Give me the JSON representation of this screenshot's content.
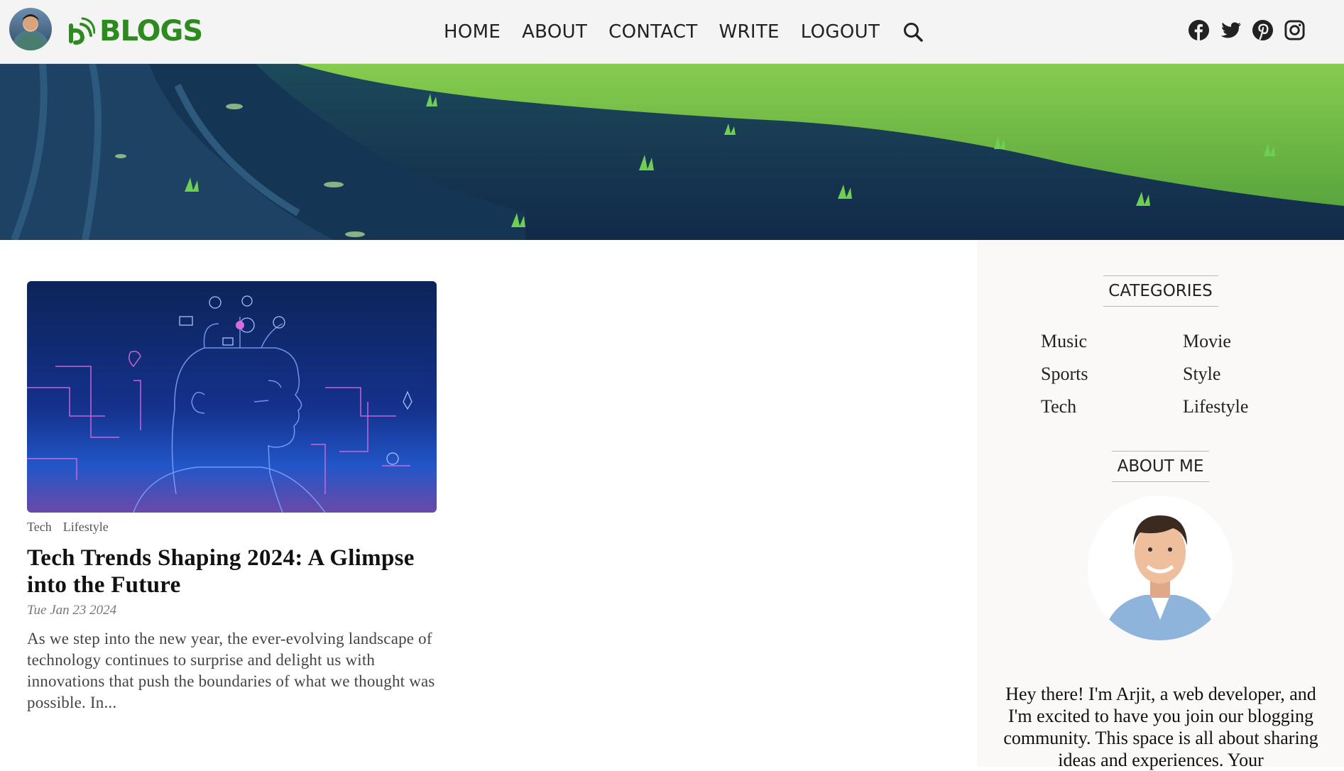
{
  "header": {
    "avatar_icon": "user-avatar",
    "logo": {
      "icon": "blog-logo-icon",
      "text": "BLOGS",
      "color": "#2d8a1f"
    },
    "nav": [
      {
        "label": "HOME"
      },
      {
        "label": "ABOUT"
      },
      {
        "label": "CONTACT"
      },
      {
        "label": "WRITE"
      },
      {
        "label": "LOGOUT"
      }
    ],
    "search_icon": "search-icon",
    "social_icons": [
      "facebook-icon",
      "twitter-icon",
      "pinterest-icon",
      "instagram-icon"
    ]
  },
  "hero": {
    "image": "forest-grass-illustration"
  },
  "posts": [
    {
      "image": "tech-head-illustration",
      "categories": [
        "Tech",
        "Lifestyle"
      ],
      "title": "Tech Trends Shaping 2024: A Glimpse into the Future",
      "date": "Tue Jan 23 2024",
      "excerpt": "As we step into the new year, the ever-evolving landscape of technology continues to surprise and delight us with innovations that push the boundaries of what we thought was possible. In..."
    }
  ],
  "sidebar": {
    "categories_heading": "CATEGORIES",
    "categories": [
      "Music",
      "Movie",
      "Sports",
      "Style",
      "Tech",
      "Lifestyle"
    ],
    "about_heading": "ABOUT ME",
    "about_photo": "profile-photo",
    "about_text": "Hey there! I'm Arjit, a web developer, and I'm excited to have you join our blogging community. This space is all about sharing ideas and experiences. Your"
  }
}
